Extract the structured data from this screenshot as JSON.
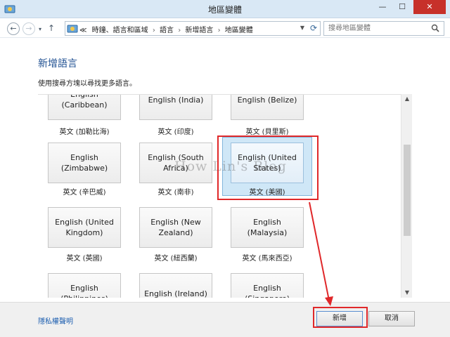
{
  "window": {
    "title": "地區變體",
    "minimize": "—",
    "maximize": "☐",
    "close": "✕"
  },
  "nav": {
    "back": "←",
    "forward": "→",
    "history": "▾",
    "up": "↑",
    "breadcrumb": [
      "≪",
      "時鐘、語言和區域",
      "語言",
      "新增語言",
      "地區變體"
    ],
    "search_placeholder": "搜尋地區變體"
  },
  "content": {
    "heading": "新增語言",
    "instruction": "使用搜尋方塊以尋找更多語言。",
    "tiles": [
      {
        "name": "English (Caribbean)",
        "label": "英文 (加勒比海)",
        "partial": true
      },
      {
        "name": "English (India)",
        "label": "英文 (印度)",
        "partial": true
      },
      {
        "name": "English (Belize)",
        "label": "英文 (貝里斯)",
        "partial": true
      },
      {
        "name": "English (Zimbabwe)",
        "label": "英文 (辛巴威)"
      },
      {
        "name": "English (South Africa)",
        "label": "英文 (南非)"
      },
      {
        "name": "English (United States)",
        "label": "英文 (美國)",
        "selected": true
      },
      {
        "name": "English (United Kingdom)",
        "label": "英文 (英國)"
      },
      {
        "name": "English (New Zealand)",
        "label": "英文 (紐西蘭)"
      },
      {
        "name": "English (Malaysia)",
        "label": "英文 (馬來西亞)"
      },
      {
        "name": "English (Philippines)",
        "label": "",
        "partial": true
      },
      {
        "name": "English (Ireland)",
        "label": "",
        "partial": true
      },
      {
        "name": "English (Singapore)",
        "label": "",
        "partial": true
      }
    ],
    "watermark": "How Lin's Blog"
  },
  "footer": {
    "privacy_link": "隱私權聲明",
    "add_button": "新增",
    "cancel_button": "取消"
  },
  "colors": {
    "accent": "#1e4f91",
    "selection": "#cfe7f7",
    "annotation": "#e0282a",
    "close": "#c7312a"
  }
}
